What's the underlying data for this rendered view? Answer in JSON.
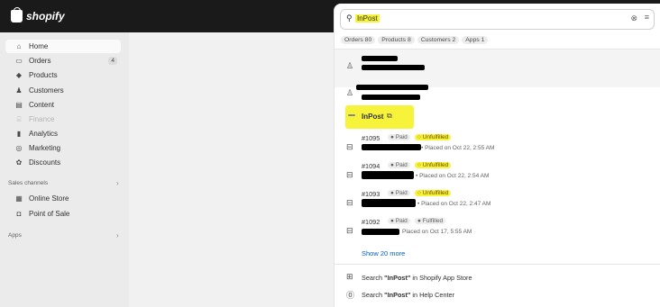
{
  "brand": {
    "name": "shopify"
  },
  "sidebar": {
    "items": [
      {
        "label": "Home",
        "icon": "home-icon",
        "glyph": "⌂",
        "active": true
      },
      {
        "label": "Orders",
        "icon": "inbox-icon",
        "glyph": "▭",
        "badge": "4"
      },
      {
        "label": "Products",
        "icon": "tag-icon",
        "glyph": "◆"
      },
      {
        "label": "Customers",
        "icon": "person-icon",
        "glyph": "♟"
      },
      {
        "label": "Content",
        "icon": "content-icon",
        "glyph": "▤"
      },
      {
        "label": "Finance",
        "icon": "bank-icon",
        "glyph": "⌸",
        "disabled": true
      },
      {
        "label": "Analytics",
        "icon": "bar-chart-icon",
        "glyph": "▮"
      },
      {
        "label": "Marketing",
        "icon": "target-icon",
        "glyph": "◎"
      },
      {
        "label": "Discounts",
        "icon": "discount-icon",
        "glyph": "✿"
      }
    ],
    "sales_channels_label": "Sales channels",
    "channels": [
      {
        "label": "Online Store",
        "icon": "store-icon",
        "glyph": "▦"
      },
      {
        "label": "Point of Sale",
        "icon": "pos-icon",
        "glyph": "◘"
      }
    ],
    "apps_label": "Apps"
  },
  "search": {
    "query": "InPost",
    "icon": "search-icon",
    "clear_icon": "clear-icon",
    "filter_icon": "filter-icon"
  },
  "filters": [
    {
      "label": "Orders 80"
    },
    {
      "label": "Products 8"
    },
    {
      "label": "Customers 2"
    },
    {
      "label": "Apps 1"
    }
  ],
  "app_result": {
    "name": "InPost",
    "icon": "external-link-icon"
  },
  "orders": [
    {
      "number": "#1095",
      "payment": "● Paid",
      "status": "○ Unfulfilled",
      "placed": "• Placed on Oct 22, 2:55 AM"
    },
    {
      "number": "#1094",
      "payment": "● Paid",
      "status": "○ Unfulfilled",
      "placed": "• Placed on Oct 22, 2:54 AM"
    },
    {
      "number": "#1093",
      "payment": "● Paid",
      "status": "○ Unfulfilled",
      "placed": "• Placed on Oct 22, 2:47 AM"
    },
    {
      "number": "#1092",
      "payment": "● Paid",
      "status": "● Fulfilled",
      "placed": "Placed on Oct 17, 5:55 AM"
    }
  ],
  "show_more": "Show 20 more",
  "footer": [
    {
      "prefix": "Search ",
      "query": "\"InPost\"",
      "suffix": " in Shopify App Store",
      "icon": "app-store-icon"
    },
    {
      "prefix": "Search ",
      "query": "\"InPost\"",
      "suffix": " in Help Center",
      "icon": "help-icon"
    }
  ],
  "colors": {
    "highlight": "#f7f23a",
    "topbar": "#1a1a1a",
    "link": "#005bd3"
  }
}
